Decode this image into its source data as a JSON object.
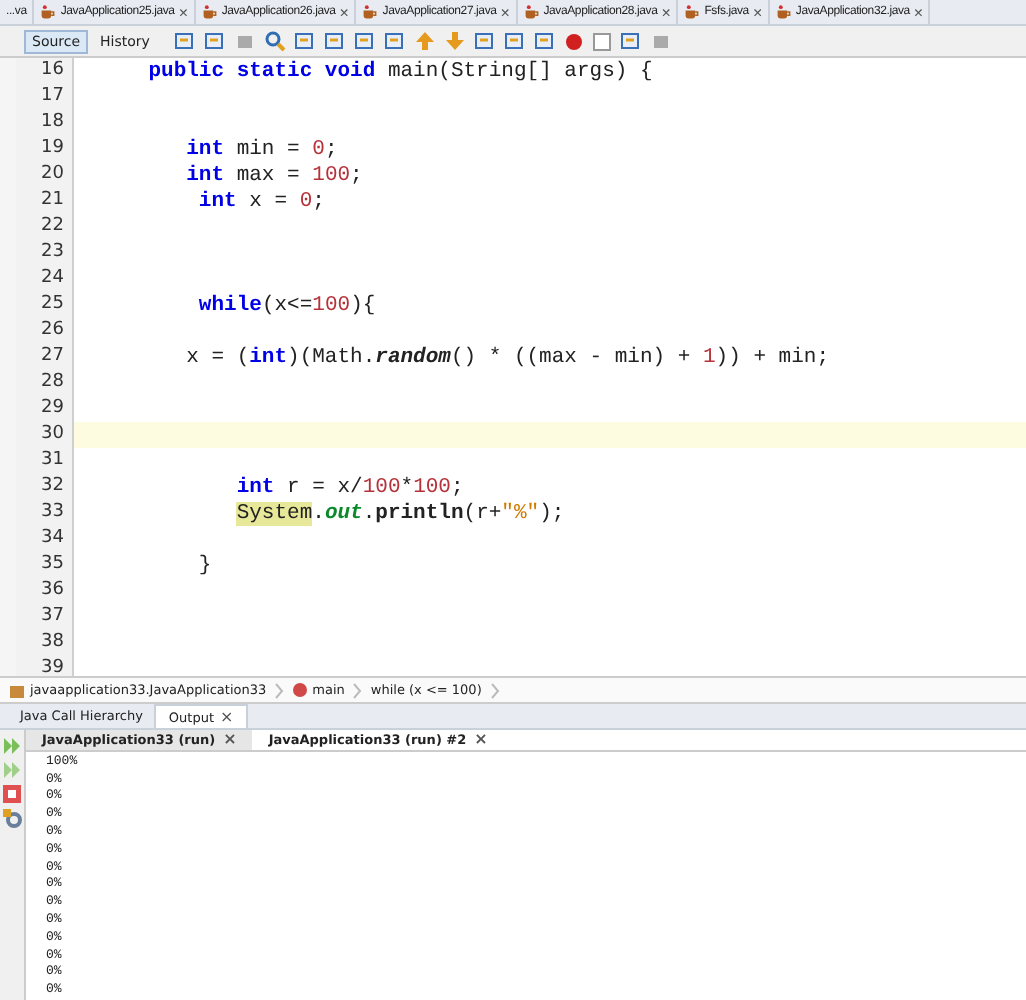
{
  "editor_tabs": [
    {
      "label": "...va",
      "closable": false,
      "selected": false
    },
    {
      "label": "JavaApplication25.java",
      "closable": true,
      "selected": false
    },
    {
      "label": "JavaApplication26.java",
      "closable": true,
      "selected": false
    },
    {
      "label": "JavaApplication27.java",
      "closable": true,
      "selected": false
    },
    {
      "label": "JavaApplication28.java",
      "closable": true,
      "selected": false
    },
    {
      "label": "Fsfs.java",
      "closable": true,
      "selected": false
    },
    {
      "label": "JavaApplication32.java",
      "closable": true,
      "selected": false
    }
  ],
  "close_glyph": "×",
  "view_tabs": [
    {
      "label": "Source",
      "selected": true
    },
    {
      "label": "History",
      "selected": false
    }
  ],
  "code_lines": [
    {
      "number": "16",
      "highlighted": false,
      "tokens": [
        {
          "text": "    public static void",
          "kind": "keyword"
        },
        {
          "text": " main(String[] args) {",
          "kind": "plain"
        }
      ]
    },
    {
      "number": "17",
      "highlighted": false
    },
    {
      "number": "18",
      "highlighted": false
    },
    {
      "number": "19",
      "highlighted": false,
      "tokens": [
        {
          "text": "       int",
          "kind": "keyword"
        },
        {
          "text": " min = ",
          "kind": "plain"
        },
        {
          "text": "0",
          "kind": "number"
        },
        {
          "text": ";",
          "kind": "plain"
        }
      ]
    },
    {
      "number": "20",
      "highlighted": false,
      "tokens": [
        {
          "text": "       int",
          "kind": "keyword"
        },
        {
          "text": " max = ",
          "kind": "plain"
        },
        {
          "text": "100",
          "kind": "number"
        },
        {
          "text": ";",
          "kind": "plain"
        }
      ]
    },
    {
      "number": "21",
      "highlighted": false,
      "tokens": [
        {
          "text": "        int",
          "kind": "keyword"
        },
        {
          "text": " x = ",
          "kind": "plain"
        },
        {
          "text": "0",
          "kind": "number"
        },
        {
          "text": ";",
          "kind": "plain"
        }
      ]
    },
    {
      "number": "22",
      "highlighted": false
    },
    {
      "number": "23",
      "highlighted": false
    },
    {
      "number": "24",
      "highlighted": false
    },
    {
      "number": "25",
      "highlighted": false,
      "tokens": [
        {
          "text": "        while",
          "kind": "keyword"
        },
        {
          "text": "(x<=",
          "kind": "plain"
        },
        {
          "text": "100",
          "kind": "number"
        },
        {
          "text": "){",
          "kind": "plain"
        }
      ]
    },
    {
      "number": "26",
      "highlighted": false
    },
    {
      "number": "27",
      "highlighted": false,
      "tokens": [
        {
          "text": "       x = (",
          "kind": "plain"
        },
        {
          "text": "int",
          "kind": "keyword"
        },
        {
          "text": ")(Math.",
          "kind": "plain"
        },
        {
          "text": "random",
          "kind": "method"
        },
        {
          "text": "() * ((max - min) + ",
          "kind": "plain"
        },
        {
          "text": "1",
          "kind": "number"
        },
        {
          "text": ")) + min;",
          "kind": "plain"
        }
      ]
    },
    {
      "number": "28",
      "highlighted": false
    },
    {
      "number": "29",
      "highlighted": false
    },
    {
      "number": "30",
      "highlighted": true
    },
    {
      "number": "31",
      "highlighted": false
    },
    {
      "number": "32",
      "highlighted": false,
      "tokens": [
        {
          "text": "           int",
          "kind": "keyword"
        },
        {
          "text": " r = x/",
          "kind": "plain"
        },
        {
          "text": "100",
          "kind": "number"
        },
        {
          "text": "*",
          "kind": "plain"
        },
        {
          "text": "100",
          "kind": "number"
        },
        {
          "text": ";",
          "kind": "plain"
        }
      ]
    },
    {
      "number": "33",
      "highlighted": false,
      "tokens": [
        {
          "text": "           System",
          "kind": "class"
        },
        {
          "text": ".",
          "kind": "plain"
        },
        {
          "text": "out",
          "kind": "field"
        },
        {
          "text": ".",
          "kind": "plain"
        },
        {
          "text": "println",
          "kind": "call"
        },
        {
          "text": "(r+",
          "kind": "plain"
        },
        {
          "text": "\"%\"",
          "kind": "string"
        },
        {
          "text": ");",
          "kind": "plain"
        }
      ]
    },
    {
      "number": "34",
      "highlighted": false
    },
    {
      "number": "35",
      "highlighted": false,
      "tokens": [
        {
          "text": "        }",
          "kind": "plain"
        }
      ]
    },
    {
      "number": "36",
      "highlighted": false
    },
    {
      "number": "37",
      "highlighted": false
    },
    {
      "number": "38",
      "highlighted": false
    },
    {
      "number": "39",
      "highlighted": false
    }
  ],
  "breadcrumbs": [
    "javaapplication33.JavaApplication33",
    "main",
    "while (x <= 100)"
  ],
  "panel_tabs": [
    {
      "label": "Java Call Hierarchy",
      "selected": false,
      "closable": false
    },
    {
      "label": "Output",
      "selected": true,
      "closable": true
    }
  ],
  "output_tabs": [
    {
      "label": "JavaApplication33 (run)",
      "selected": false
    },
    {
      "label": "JavaApplication33 (run) #2",
      "selected": true
    }
  ],
  "output_lines": [
    "100%",
    "0%",
    "0%",
    "0%",
    "0%",
    "0%",
    "0%",
    "0%",
    "0%",
    "0%",
    "0%",
    "0%",
    "0%",
    "0%"
  ]
}
